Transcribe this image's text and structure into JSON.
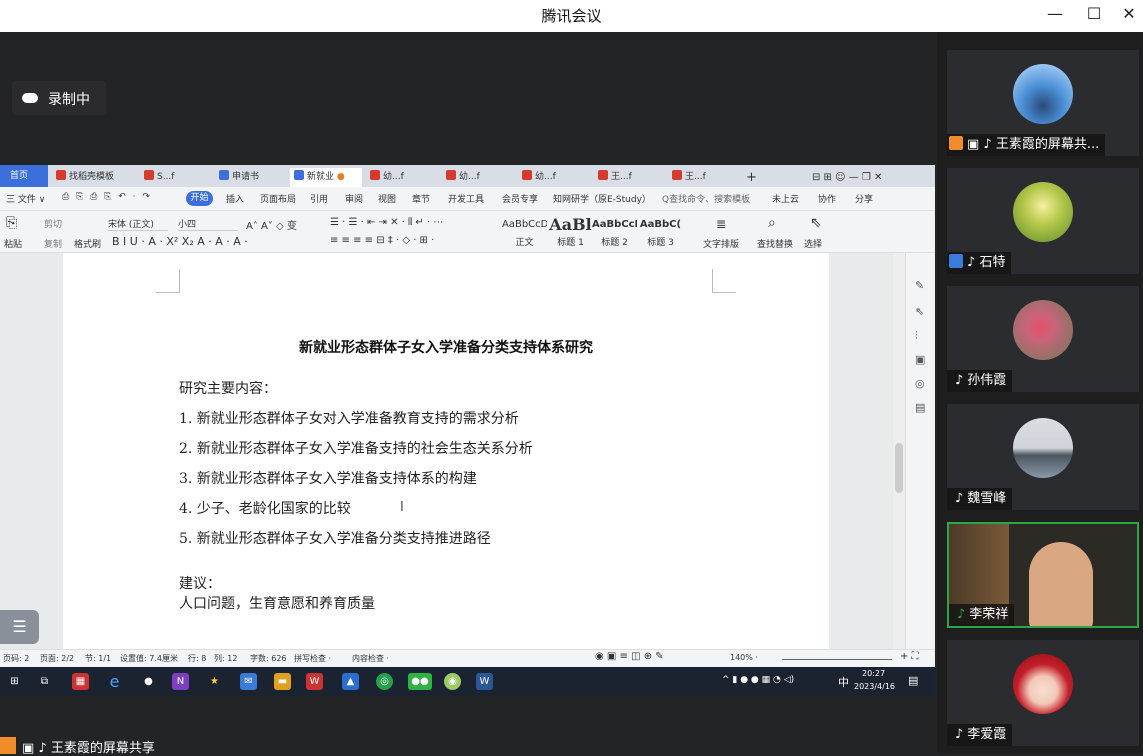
{
  "window": {
    "title": "腾讯会议",
    "minimize": "—",
    "maximize": "☐",
    "close": "✕"
  },
  "recording": {
    "label": "录制中"
  },
  "wps": {
    "tabs": [
      {
        "label": "首页"
      },
      {
        "label": "找稻壳模板"
      },
      {
        "label": "S...f"
      },
      {
        "label": "申请书"
      },
      {
        "label": "新就业"
      },
      {
        "label": "幼...f"
      },
      {
        "label": "幼...f"
      },
      {
        "label": "幼...f"
      },
      {
        "label": "王...f"
      },
      {
        "label": "王...f"
      },
      {
        "label": "+"
      }
    ],
    "menu": [
      "三 文件 ∨",
      "开始",
      "插入",
      "页面布局",
      "引用",
      "审阅",
      "视图",
      "章节",
      "开发工具",
      "会员专享",
      "知网研学（原E-Study）",
      "Q查找命令、搜索模板",
      "未上云",
      "协作",
      "分享"
    ],
    "ribbon": {
      "paste": "粘贴",
      "cut": "剪切",
      "copy": "复制",
      "format_painter": "格式刷",
      "font": "宋体 (正文)",
      "size": "小四",
      "styles": [
        {
          "preview": "AaBbCcD",
          "label": "正文"
        },
        {
          "preview": "AaBl",
          "label": "标题 1"
        },
        {
          "preview": "AaBbCcI",
          "label": "标题 2"
        },
        {
          "preview": "AaBbC(",
          "label": "标题 3"
        }
      ],
      "text_layout": "文字排版",
      "find_replace": "查找替换",
      "select": "选择"
    },
    "document": {
      "title": "新就业形态群体子女入学准备分类支持体系研究",
      "section_heading": "研究主要内容：",
      "items": [
        "1.  新就业形态群体子女对入学准备教育支持的需求分析",
        "2.  新就业形态群体子女入学准备支持的社会生态关系分析",
        "3.  新就业形态群体子女入学准备支持体系的构建",
        "4.  少子、老龄化国家的比较",
        "5.  新就业形态群体子女入学准备分类支持推进路径"
      ],
      "suggestion_heading": "建议：",
      "suggestion_text": "人口问题，生育意愿和养育质量"
    },
    "status": {
      "page": "页码: 2",
      "pages": "页面: 2/2",
      "section": "节: 1/1",
      "setting": "设置值: 7.4厘米",
      "row": "行: 8",
      "col": "列: 12",
      "words": "字数: 626",
      "spell": "拼写检查 ·",
      "content_check": "内容检查 ·",
      "zoom": "140% ·"
    },
    "taskbar": {
      "time": "20:27",
      "date": "2023/4/16",
      "ime": "中"
    }
  },
  "share_label": "王素霞的屏幕共享",
  "participants": [
    {
      "name": "王素霞的屏幕共...",
      "avatar": "sky-photo"
    },
    {
      "name": "石特",
      "avatar": "flower-field"
    },
    {
      "name": "孙伟霞",
      "avatar": "pink-flower"
    },
    {
      "name": "魏雪峰",
      "avatar": "lake-road"
    },
    {
      "name": "李荣祥",
      "avatar": "video"
    },
    {
      "name": "李爱霞",
      "avatar": "cartoon-girl"
    }
  ],
  "colors": {
    "accent": "#3b6fd9",
    "meeting_bg": "#232426",
    "active_speaker": "#2aa845",
    "share_orange": "#f08c2a"
  }
}
